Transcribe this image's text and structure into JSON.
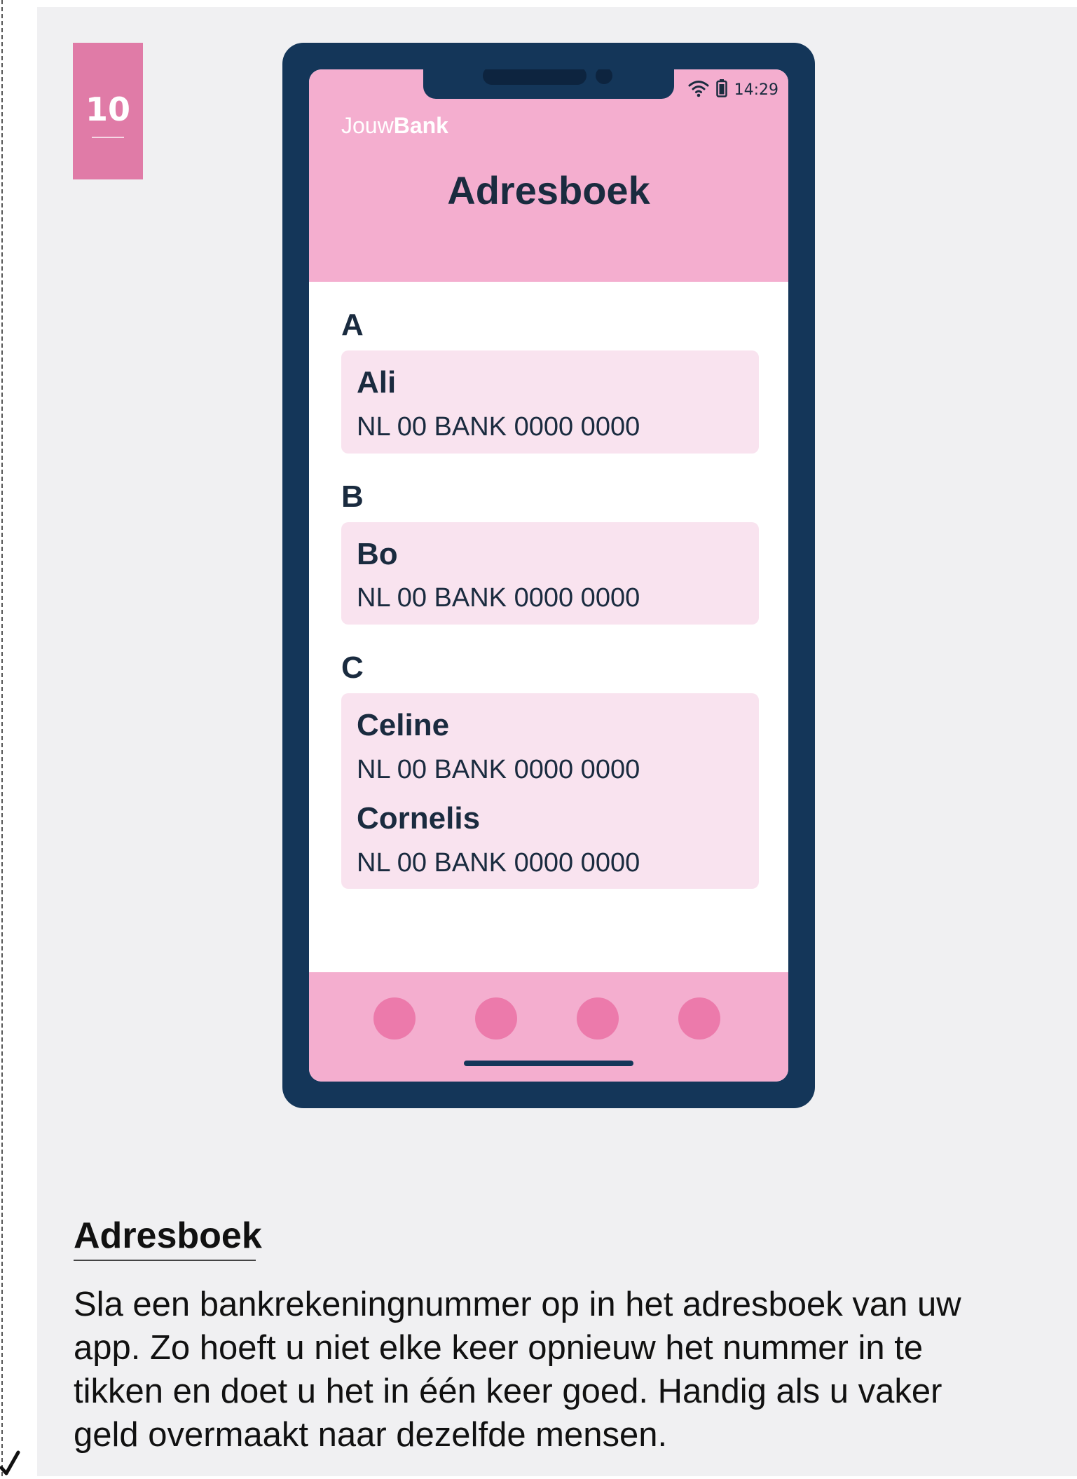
{
  "page": {
    "number": "10"
  },
  "phone": {
    "status_bar": {
      "time": "14:29",
      "icons": [
        "wifi-icon",
        "battery-icon"
      ]
    },
    "brand": {
      "prefix": "Jouw",
      "suffix": "Bank"
    },
    "title": "Adresboek",
    "sections": [
      {
        "letter": "A",
        "contacts": [
          {
            "name": "Ali",
            "iban": "NL 00 BANK 0000 0000"
          }
        ]
      },
      {
        "letter": "B",
        "contacts": [
          {
            "name": "Bo",
            "iban": "NL 00 BANK 0000 0000"
          }
        ]
      },
      {
        "letter": "C",
        "contacts": [
          {
            "name": "Celine",
            "iban": "NL 00 BANK 0000 0000"
          },
          {
            "name": "Cornelis",
            "iban": "NL 00 BANK 0000 0000"
          }
        ]
      }
    ],
    "nav_buttons": 4
  },
  "description": {
    "title": "Adresboek",
    "body": "Sla een bankrekeningnummer op in het adresboek van uw app. Zo hoeft u niet elke keer opnieuw het nummer in te tikken en doet u het in één keer goed. Handig als u vaker geld overmaakt naar dezelfde mensen."
  },
  "colors": {
    "page_background": "#f0f0f2",
    "phone_frame": "#143659",
    "header_pink": "#f4aecf",
    "card_pink": "#f9e3ef",
    "nav_dot_pink": "#ec7aab",
    "page_number_pink": "#e07ba7",
    "text_dark": "#1a2b3f"
  }
}
